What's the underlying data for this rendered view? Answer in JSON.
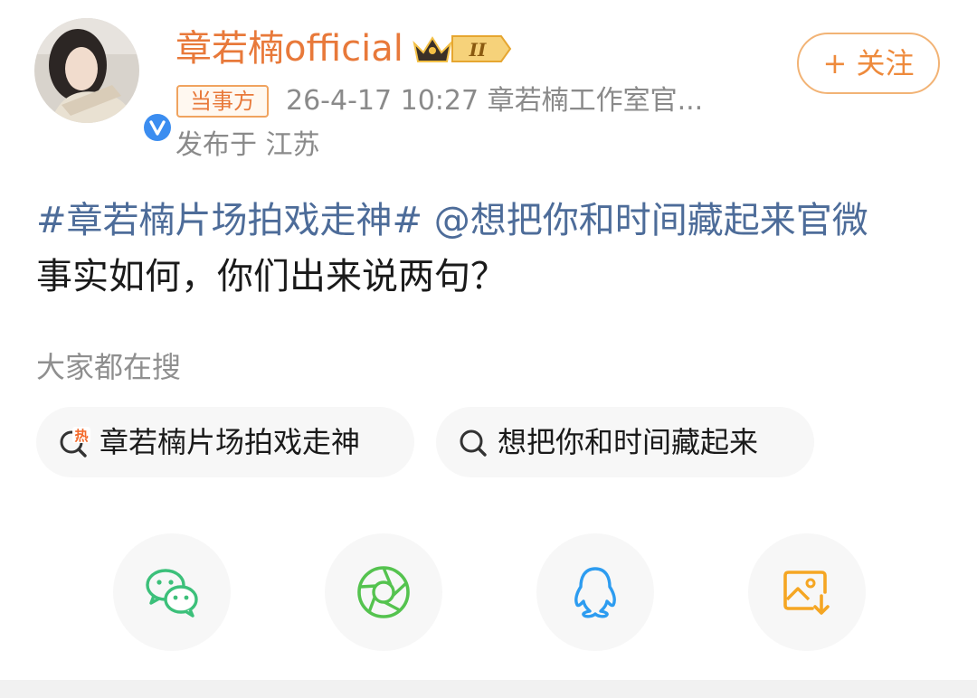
{
  "post": {
    "username": "章若楠official",
    "follow_label": "+ 关注",
    "tag": "当事方",
    "meta": "26-4-17 10:27  章若楠工作室官...",
    "location": "发布于 江苏",
    "content": {
      "hashtag": "#章若楠片场拍戏走神#",
      "mention": "@想把你和时间藏起来官微",
      "text": "事实如何，你们出来说两句？"
    }
  },
  "search": {
    "title": "大家都在搜",
    "chips": [
      {
        "label": "章若楠片场拍戏走神",
        "icon": "hot-search-icon"
      },
      {
        "label": "想把你和时间藏起来",
        "icon": "search-icon"
      }
    ]
  },
  "share": {
    "buttons": [
      {
        "name": "wechat",
        "icon": "wechat-icon",
        "color": "#3cc07a"
      },
      {
        "name": "moments",
        "icon": "wechat-moments-icon",
        "color": "#55c34f"
      },
      {
        "name": "qq",
        "icon": "qq-icon",
        "color": "#2d9cf0"
      },
      {
        "name": "save-image",
        "icon": "save-image-icon",
        "color": "#f5a623"
      }
    ]
  },
  "colors": {
    "accent_orange": "#e8793a",
    "link_blue": "#4d6c99",
    "verified_blue": "#3b8df0"
  }
}
